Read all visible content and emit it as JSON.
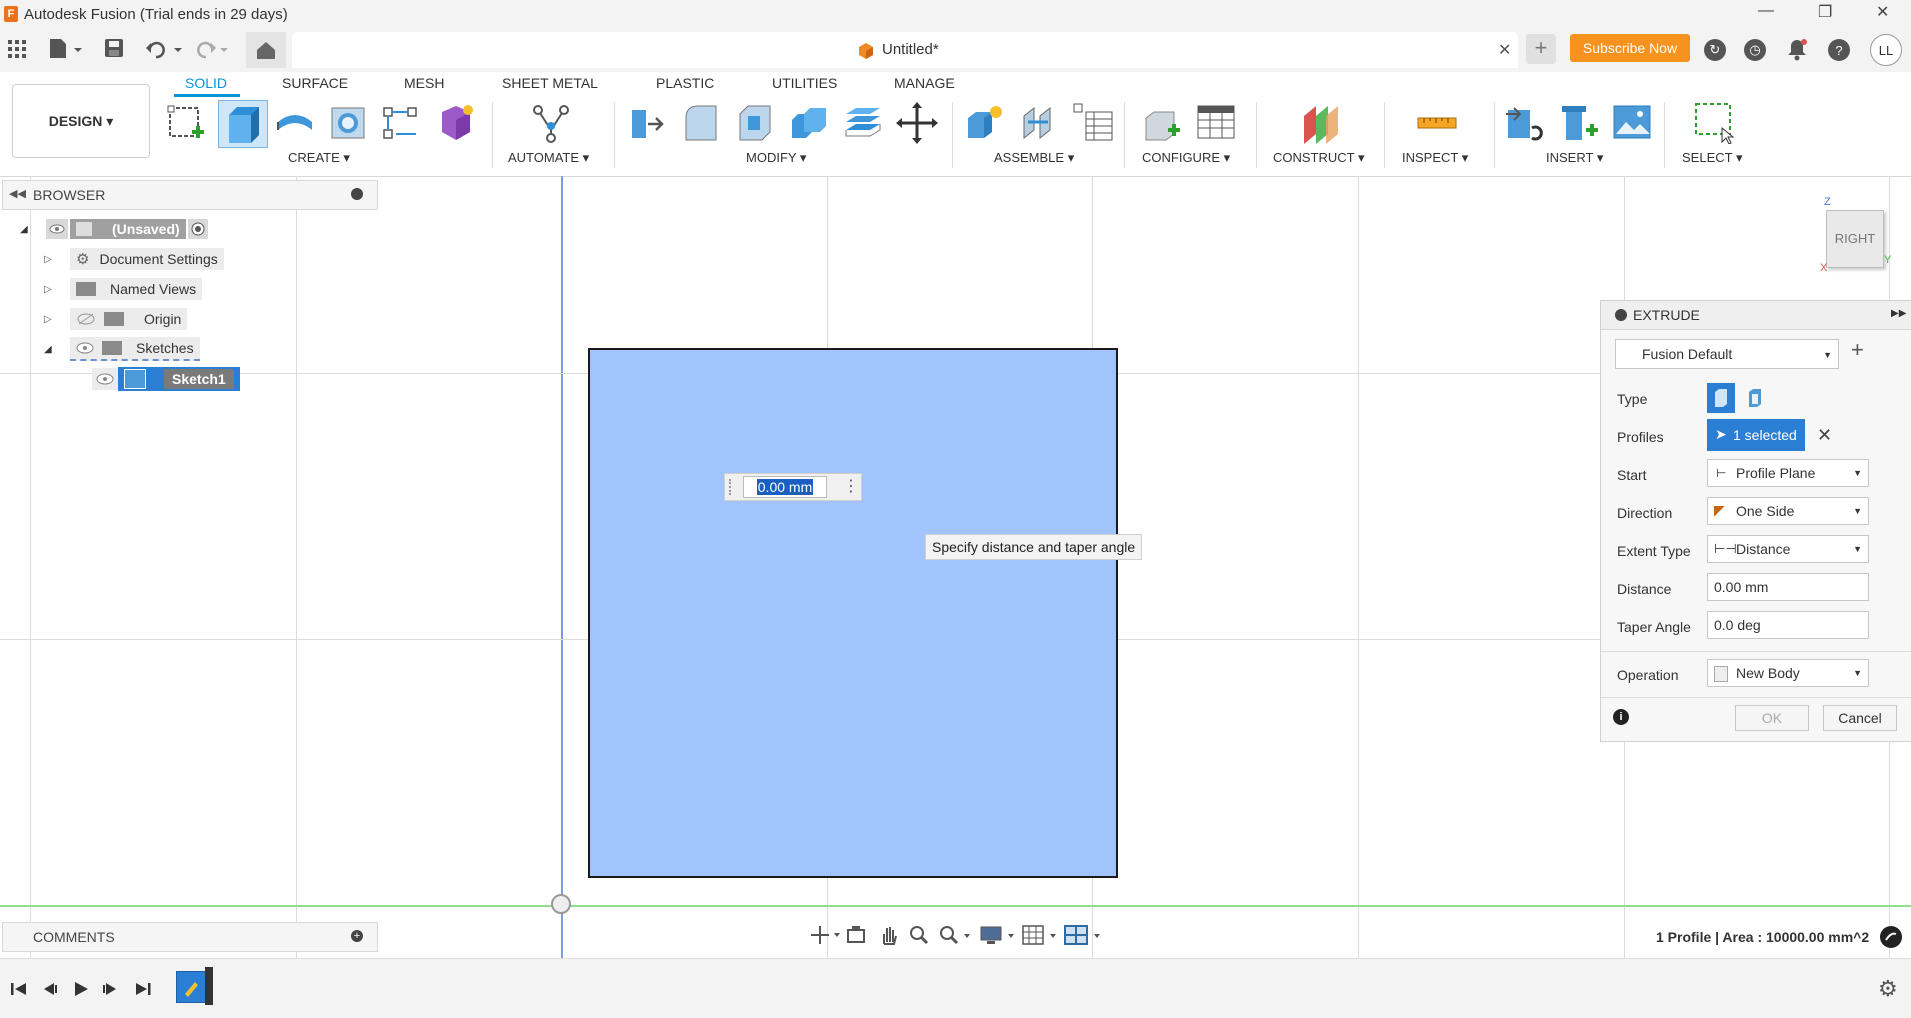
{
  "window": {
    "title": "Autodesk Fusion (Trial ends in 29 days)",
    "min_glyph": "—",
    "max_glyph": "❐",
    "close_glyph": "✕"
  },
  "appbar": {
    "doc_tab_title": "Untitled*",
    "close_tab_glyph": "✕",
    "subscribe_label": "Subscribe Now",
    "user_initials": "LL",
    "help_glyph": "?"
  },
  "ribbon": {
    "workspace_label": "DESIGN ▾",
    "tabs": [
      "SOLID",
      "SURFACE",
      "MESH",
      "SHEET METAL",
      "PLASTIC",
      "UTILITIES",
      "MANAGE"
    ],
    "groups": [
      "CREATE ▾",
      "AUTOMATE ▾",
      "MODIFY ▾",
      "ASSEMBLE ▾",
      "CONFIGURE ▾",
      "CONSTRUCT ▾",
      "INSPECT ▾",
      "INSERT ▾",
      "SELECT ▾"
    ]
  },
  "browser": {
    "title": "BROWSER",
    "root": "(Unsaved)",
    "items": [
      "Document Settings",
      "Named Views",
      "Origin",
      "Sketches"
    ],
    "sketch": "Sketch1"
  },
  "viewcube": {
    "face": "RIGHT",
    "axis_z": "Z",
    "axis_y": "Y",
    "axis_x": "X"
  },
  "canvas": {
    "distance_value": "0.00 mm",
    "tooltip": "Specify distance and taper angle"
  },
  "extrude": {
    "title": "EXTRUDE",
    "preset": "Fusion Default",
    "rows": {
      "type": "Type",
      "profiles": "Profiles",
      "start": "Start",
      "direction": "Direction",
      "extent_type": "Extent Type",
      "distance": "Distance",
      "taper_angle": "Taper Angle",
      "operation": "Operation"
    },
    "profiles_value": "1 selected",
    "start_value": "Profile Plane",
    "direction_value": "One Side",
    "extent_value": "Distance",
    "distance_value": "0.00 mm",
    "taper_value": "0.0 deg",
    "operation_value": "New Body",
    "ok_label": "OK",
    "cancel_label": "Cancel"
  },
  "comments": {
    "title": "COMMENTS"
  },
  "status": {
    "text": "1 Profile | Area : 10000.00 mm^2"
  }
}
